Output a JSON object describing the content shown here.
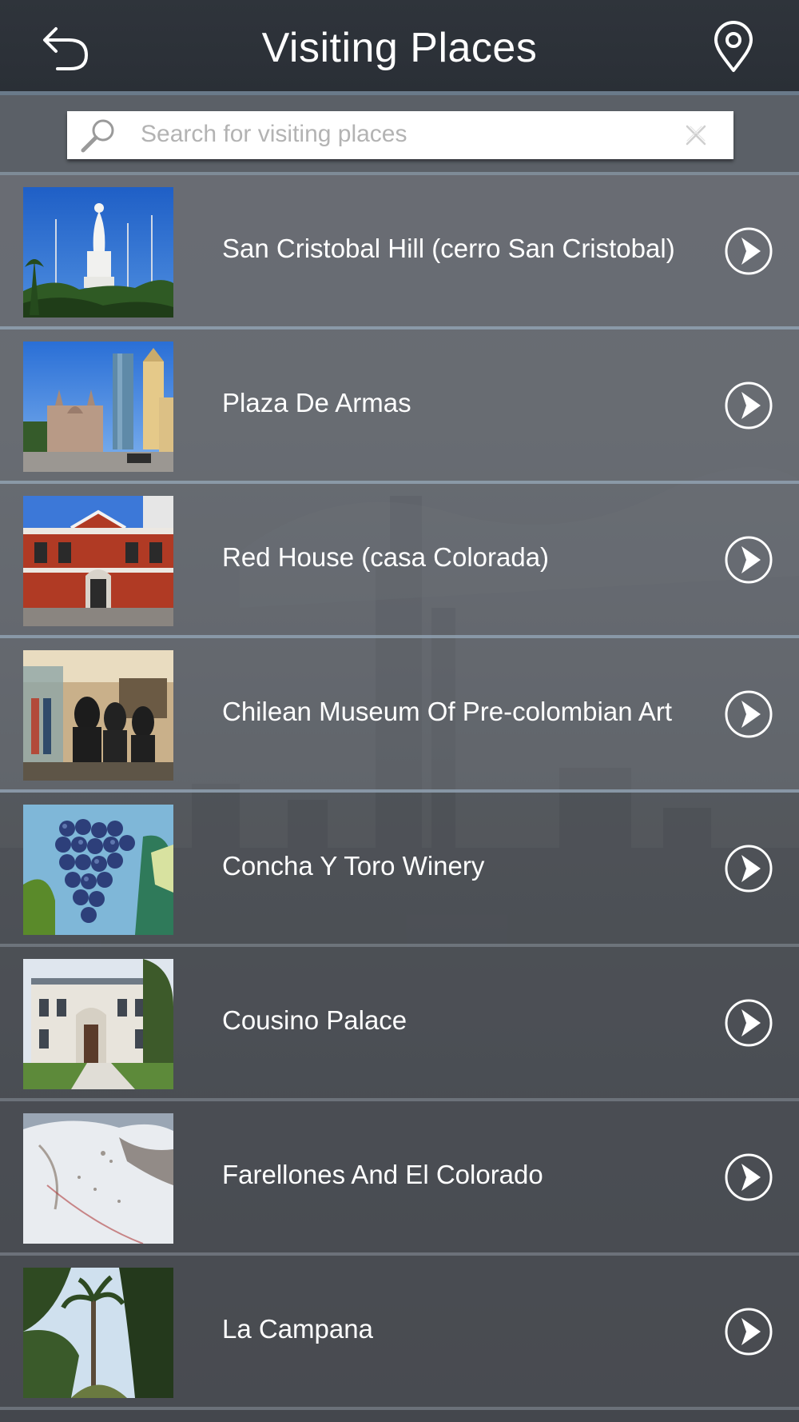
{
  "header": {
    "title": "Visiting Places",
    "back_icon": "back-arrow-icon",
    "location_icon": "map-pin-icon"
  },
  "search": {
    "placeholder": "Search for visiting places",
    "value": "",
    "search_icon": "magnifier-icon",
    "clear_icon": "close-icon"
  },
  "places": [
    {
      "name": "San Cristobal Hill (cerro San Cristobal)",
      "image": "statue on hill against blue sky"
    },
    {
      "name": "Plaza De Armas",
      "image": "cathedral and towers on plaza"
    },
    {
      "name": "Red House (casa Colorada)",
      "image": "red colonial house facade"
    },
    {
      "name": "Chilean Museum Of Pre-colombian Art",
      "image": "museum display of figures"
    },
    {
      "name": "Concha Y Toro Winery",
      "image": "bunch of blue grapes"
    },
    {
      "name": "Cousino Palace",
      "image": "white palace with garden"
    },
    {
      "name": "Farellones And El Colorado",
      "image": "snowy ski slopes"
    },
    {
      "name": "La Campana",
      "image": "palm tree forest"
    }
  ],
  "colors": {
    "header_bg": "#2c3138",
    "accent_line": "#7e8b97",
    "text": "#ffffff",
    "placeholder": "#b3b3b3"
  }
}
